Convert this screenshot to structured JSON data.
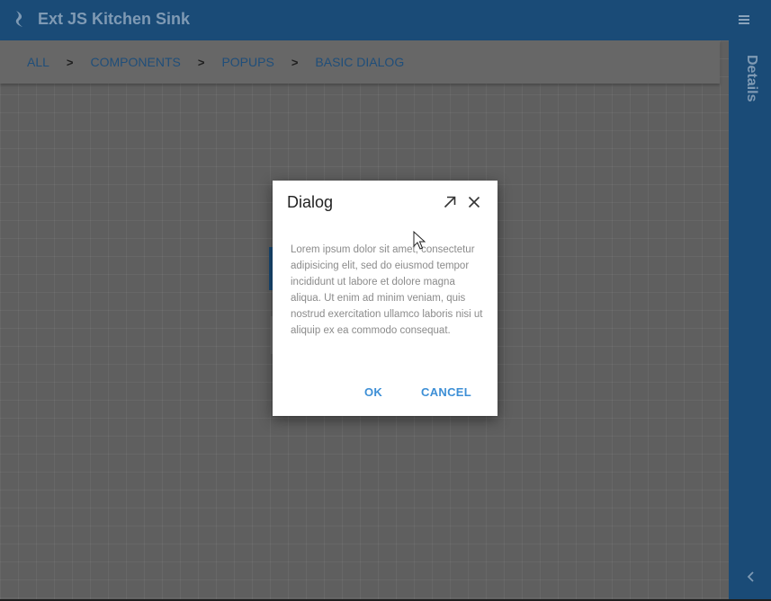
{
  "header": {
    "app_title": "Ext JS Kitchen Sink",
    "logo_icon": "sencha-logo-icon",
    "menu_icon": "hamburger-menu-icon"
  },
  "breadcrumb": {
    "items": [
      "ALL",
      "COMPONENTS",
      "POPUPS",
      "BASIC DIALOG"
    ],
    "separator": ">"
  },
  "details_panel": {
    "label": "Details",
    "collapse_icon": "chevron-left-icon"
  },
  "dialog": {
    "title": "Dialog",
    "maximize_icon": "arrow-up-right-icon",
    "close_icon": "close-icon",
    "body": "Lorem ipsum dolor sit amet, consectetur adipisicing elit, sed do eiusmod tempor incididunt ut labore et dolore magna aliqua. Ut enim ad minim veniam, quis nostrud exercitation ullamco laboris nisi ut aliquip ex ea commodo consequat.",
    "ok_label": "OK",
    "cancel_label": "CANCEL"
  },
  "colors": {
    "header_bg": "#1a4b77",
    "accent": "#3d8fd6",
    "mask": "#5f5f5f"
  }
}
